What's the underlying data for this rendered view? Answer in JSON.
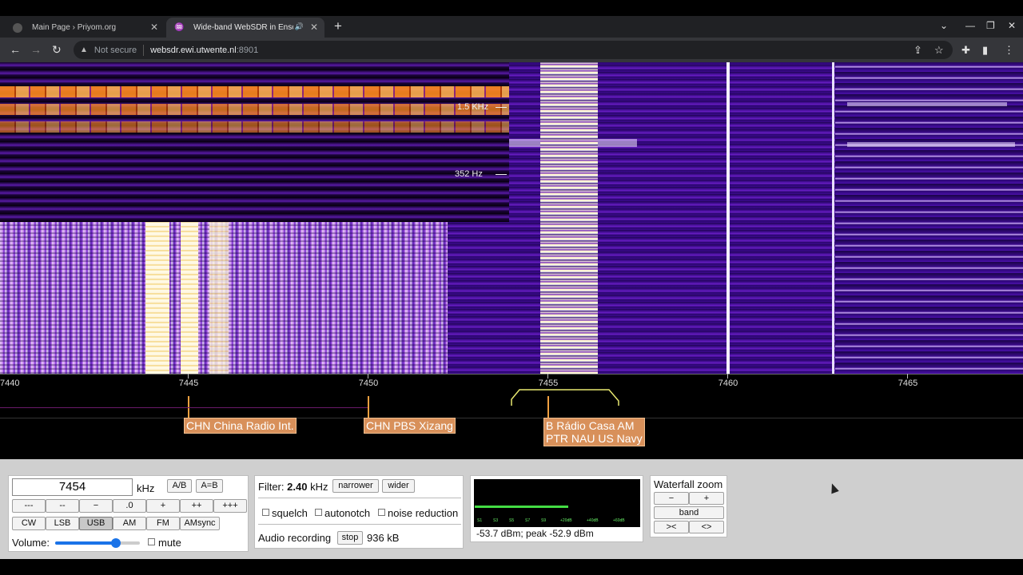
{
  "browser": {
    "tabs": [
      {
        "title": "Main Page › Priyom.org",
        "active": false
      },
      {
        "title": "Wide-band WebSDR in Ensch",
        "active": true
      }
    ],
    "address": {
      "security": "Not secure",
      "host": "websdr.ewi.utwente.nl",
      "port": ":8901"
    }
  },
  "waterfall": {
    "labels": [
      "1.5  KHz",
      "352  Hz"
    ]
  },
  "scale": {
    "ticks": [
      "7440",
      "7445",
      "7450",
      "7455",
      "7460",
      "7465"
    ]
  },
  "stations": [
    {
      "label": "CHN China Radio Int."
    },
    {
      "label": "CHN PBS Xizang"
    },
    {
      "label1": "B Rádio Casa AM",
      "label2": "PTR NAU US Navy"
    }
  ],
  "controls": {
    "frequency": "7454",
    "unit": "kHz",
    "ab": "A/B",
    "aeqb": "A=B",
    "step_buttons": [
      "---",
      "--",
      "−",
      ".0",
      "+",
      "++",
      "+++"
    ],
    "modes": [
      "CW",
      "LSB",
      "USB",
      "AM",
      "FM",
      "AMsync"
    ],
    "selected_mode": "USB",
    "volume_label": "Volume:",
    "volume_level": 0.72,
    "mute_label": "mute"
  },
  "filter": {
    "label": "Filter:",
    "value": "2.40",
    "unit": "kHz",
    "narrower": "narrower",
    "wider": "wider",
    "squelch": "squelch",
    "autonotch": "autonotch",
    "noise_reduction": "noise reduction",
    "audio_recording": "Audio recording",
    "stop": "stop",
    "size": "936 kB"
  },
  "smeter": {
    "scale_labels": [
      "S1",
      "S3",
      "S5",
      "S7",
      "S9",
      "+20dB",
      "+40dB",
      "+60dB"
    ],
    "level": 0.57,
    "readout": "-53.7 dBm; peak  -52.9 dBm"
  },
  "zoom": {
    "title": "Waterfall zoom",
    "minus": "−",
    "plus": "+",
    "band": "band",
    "narrow": "><",
    "widen": "<>"
  }
}
